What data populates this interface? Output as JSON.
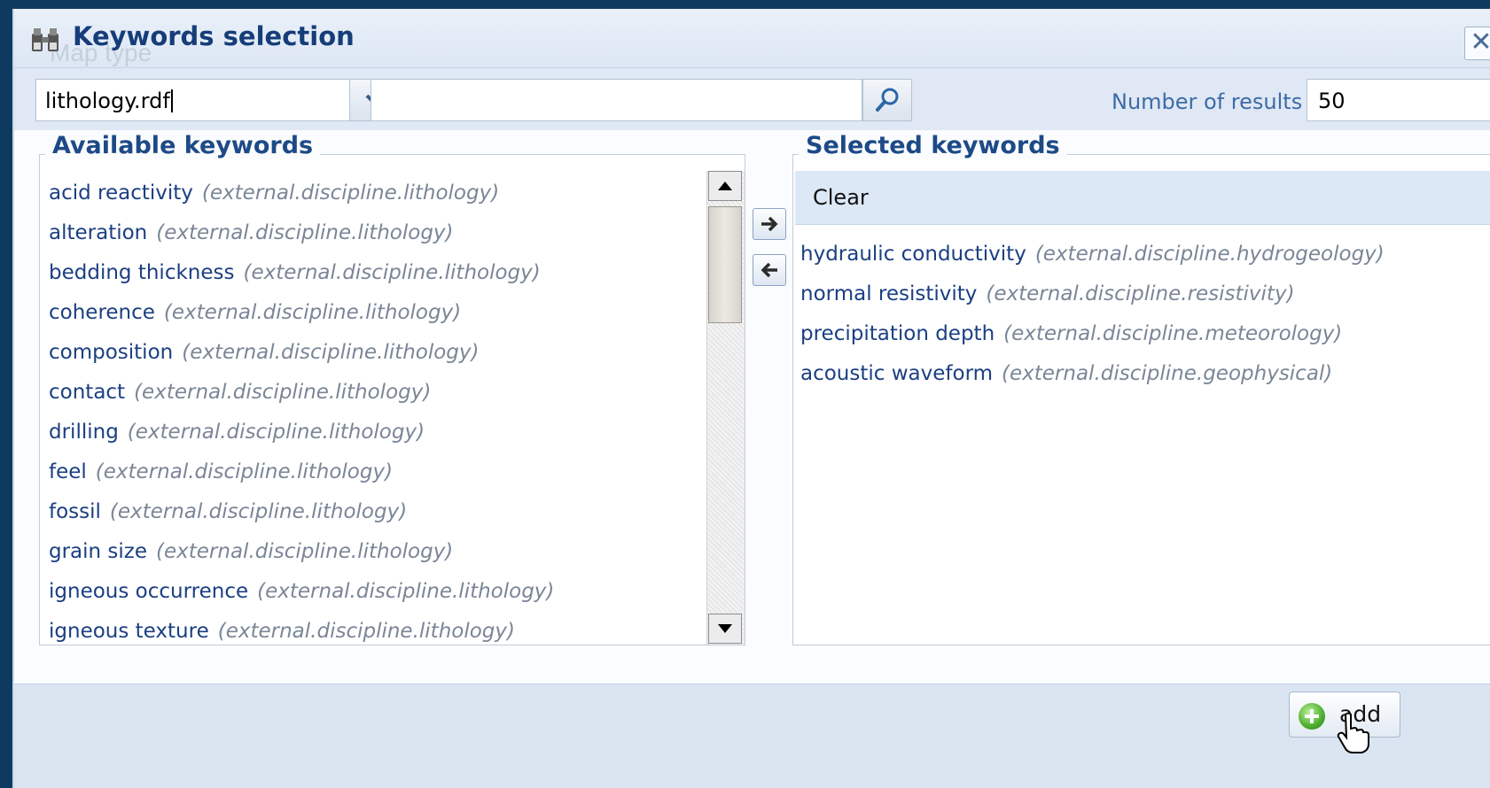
{
  "dialog": {
    "title": "Keywords selection",
    "icon": "binoculars-icon",
    "close_icon": "close-icon"
  },
  "toolbar": {
    "thesaurus_value": "lithology.rdf",
    "search_value": "",
    "search_icon": "magnifier-icon",
    "results_label": "Number of results",
    "results_value": "50"
  },
  "available": {
    "legend": "Available keywords",
    "items": [
      {
        "name": "acid reactivity",
        "path": "(external.discipline.lithology)"
      },
      {
        "name": "alteration",
        "path": "(external.discipline.lithology)"
      },
      {
        "name": "bedding thickness",
        "path": "(external.discipline.lithology)"
      },
      {
        "name": "coherence",
        "path": "(external.discipline.lithology)"
      },
      {
        "name": "composition",
        "path": "(external.discipline.lithology)"
      },
      {
        "name": "contact",
        "path": "(external.discipline.lithology)"
      },
      {
        "name": "drilling",
        "path": "(external.discipline.lithology)"
      },
      {
        "name": "feel",
        "path": "(external.discipline.lithology)"
      },
      {
        "name": "fossil",
        "path": "(external.discipline.lithology)"
      },
      {
        "name": "grain size",
        "path": "(external.discipline.lithology)"
      },
      {
        "name": "igneous occurrence",
        "path": "(external.discipline.lithology)"
      },
      {
        "name": "igneous texture",
        "path": "(external.discipline.lithology)"
      }
    ]
  },
  "selected": {
    "legend": "Selected keywords",
    "clear_label": "Clear",
    "items": [
      {
        "name": "hydraulic conductivity",
        "path": "(external.discipline.hydrogeology)"
      },
      {
        "name": "normal resistivity",
        "path": "(external.discipline.resistivity)"
      },
      {
        "name": "precipitation depth",
        "path": "(external.discipline.meteorology)"
      },
      {
        "name": "acoustic waveform",
        "path": "(external.discipline.geophysical)"
      }
    ]
  },
  "footer": {
    "add_label": "add"
  },
  "background": {
    "ghost_text": "Map type"
  }
}
